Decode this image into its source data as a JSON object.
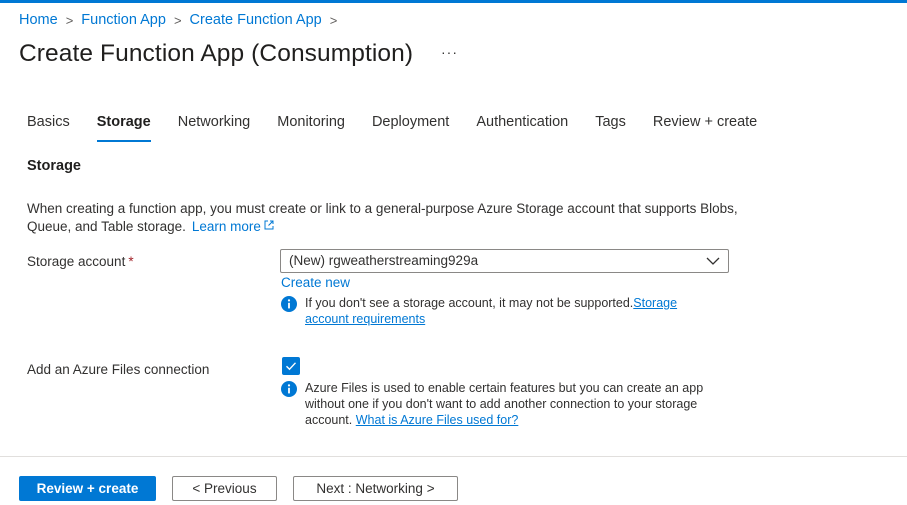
{
  "breadcrumb": {
    "items": [
      "Home",
      "Function App",
      "Create Function App"
    ],
    "separator": ">"
  },
  "page": {
    "title": "Create Function App (Consumption)",
    "more_label": "···"
  },
  "tabs": [
    {
      "label": "Basics",
      "active": false
    },
    {
      "label": "Storage",
      "active": true
    },
    {
      "label": "Networking",
      "active": false
    },
    {
      "label": "Monitoring",
      "active": false
    },
    {
      "label": "Deployment",
      "active": false
    },
    {
      "label": "Authentication",
      "active": false
    },
    {
      "label": "Tags",
      "active": false
    },
    {
      "label": "Review + create",
      "active": false
    }
  ],
  "storage": {
    "section_title": "Storage",
    "description": "When creating a function app, you must create or link to a general-purpose Azure Storage account that supports Blobs, Queue, and Table storage.",
    "learn_more": "Learn more",
    "account_label": "Storage account",
    "required_mark": "*",
    "account_value": "(New) rgweatherstreaming929a",
    "create_new": "Create new",
    "account_info": "If you don't see a storage account, it may not be supported.",
    "account_info_link": "Storage account requirements",
    "files_label": "Add an Azure Files connection",
    "files_checked": true,
    "files_info": "Azure Files is used to enable certain features but you can create an app without one if you don't want to add another connection to your storage account.",
    "files_info_link": "What is Azure Files used for?"
  },
  "footer": {
    "review_create": "Review + create",
    "previous": "< Previous",
    "next": "Next : Networking >"
  },
  "colors": {
    "accent": "#0078d4",
    "required": "#a4262c",
    "text": "#323130"
  }
}
